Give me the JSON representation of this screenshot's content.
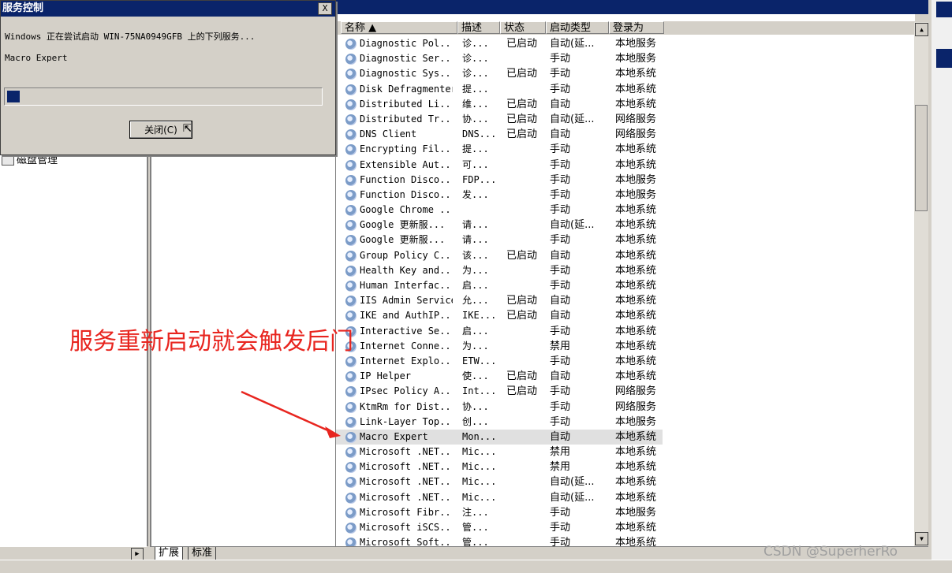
{
  "dialog": {
    "title": "服务控制",
    "close_glyph": "X",
    "message": "Windows 正在尝试启动 WIN-75NA0949GFB 上的下列服务...",
    "service": "Macro Expert",
    "progress_fraction": 0.04,
    "close_button": "关闭(C)"
  },
  "tree": {
    "item": "磁盘管理"
  },
  "list": {
    "columns": [
      "名称  ▲",
      "描述",
      "状态",
      "启动类型",
      "登录为"
    ],
    "rows": [
      {
        "name": "Diagnostic Pol...",
        "desc": "诊...",
        "status": "已启动",
        "start": "自动(延...",
        "logon": "本地服务"
      },
      {
        "name": "Diagnostic Ser...",
        "desc": "诊...",
        "status": "",
        "start": "手动",
        "logon": "本地服务"
      },
      {
        "name": "Diagnostic Sys...",
        "desc": "诊...",
        "status": "已启动",
        "start": "手动",
        "logon": "本地系统"
      },
      {
        "name": "Disk Defragmenter",
        "desc": "提...",
        "status": "",
        "start": "手动",
        "logon": "本地系统"
      },
      {
        "name": "Distributed Li...",
        "desc": "维...",
        "status": "已启动",
        "start": "自动",
        "logon": "本地系统"
      },
      {
        "name": "Distributed Tr...",
        "desc": "协...",
        "status": "已启动",
        "start": "自动(延...",
        "logon": "网络服务"
      },
      {
        "name": "DNS Client",
        "desc": "DNS...",
        "status": "已启动",
        "start": "自动",
        "logon": "网络服务"
      },
      {
        "name": "Encrypting Fil...",
        "desc": "提...",
        "status": "",
        "start": "手动",
        "logon": "本地系统"
      },
      {
        "name": "Extensible Aut...",
        "desc": "可...",
        "status": "",
        "start": "手动",
        "logon": "本地系统"
      },
      {
        "name": "Function Disco...",
        "desc": "FDP...",
        "status": "",
        "start": "手动",
        "logon": "本地服务"
      },
      {
        "name": "Function Disco...",
        "desc": "发...",
        "status": "",
        "start": "手动",
        "logon": "本地服务"
      },
      {
        "name": "Google Chrome ...",
        "desc": "",
        "status": "",
        "start": "手动",
        "logon": "本地系统"
      },
      {
        "name": "Google 更新服...",
        "desc": "请...",
        "status": "",
        "start": "自动(延...",
        "logon": "本地系统"
      },
      {
        "name": "Google 更新服...",
        "desc": "请...",
        "status": "",
        "start": "手动",
        "logon": "本地系统"
      },
      {
        "name": "Group Policy C...",
        "desc": "该...",
        "status": "已启动",
        "start": "自动",
        "logon": "本地系统"
      },
      {
        "name": "Health Key and...",
        "desc": "为...",
        "status": "",
        "start": "手动",
        "logon": "本地系统"
      },
      {
        "name": "Human Interfac...",
        "desc": "启...",
        "status": "",
        "start": "手动",
        "logon": "本地系统"
      },
      {
        "name": "IIS Admin Service",
        "desc": "允...",
        "status": "已启动",
        "start": "自动",
        "logon": "本地系统"
      },
      {
        "name": "IKE and AuthIP...",
        "desc": "IKE...",
        "status": "已启动",
        "start": "自动",
        "logon": "本地系统"
      },
      {
        "name": "Interactive Se...",
        "desc": "启...",
        "status": "",
        "start": "手动",
        "logon": "本地系统"
      },
      {
        "name": "Internet Conne...",
        "desc": "为...",
        "status": "",
        "start": "禁用",
        "logon": "本地系统"
      },
      {
        "name": "Internet Explo...",
        "desc": "ETW...",
        "status": "",
        "start": "手动",
        "logon": "本地系统"
      },
      {
        "name": "IP Helper",
        "desc": "使...",
        "status": "已启动",
        "start": "自动",
        "logon": "本地系统"
      },
      {
        "name": "IPsec Policy A...",
        "desc": "Int...",
        "status": "已启动",
        "start": "手动",
        "logon": "网络服务"
      },
      {
        "name": "KtmRm for Dist...",
        "desc": "协...",
        "status": "",
        "start": "手动",
        "logon": "网络服务"
      },
      {
        "name": "Link-Layer Top...",
        "desc": "创...",
        "status": "",
        "start": "手动",
        "logon": "本地服务"
      },
      {
        "name": "Macro Expert",
        "desc": "Mon...",
        "status": "",
        "start": "自动",
        "logon": "本地系统",
        "selected": true
      },
      {
        "name": "Microsoft .NET...",
        "desc": "Mic...",
        "status": "",
        "start": "禁用",
        "logon": "本地系统"
      },
      {
        "name": "Microsoft .NET...",
        "desc": "Mic...",
        "status": "",
        "start": "禁用",
        "logon": "本地系统"
      },
      {
        "name": "Microsoft .NET...",
        "desc": "Mic...",
        "status": "",
        "start": "自动(延...",
        "logon": "本地系统"
      },
      {
        "name": "Microsoft .NET...",
        "desc": "Mic...",
        "status": "",
        "start": "自动(延...",
        "logon": "本地系统"
      },
      {
        "name": "Microsoft Fibr...",
        "desc": "注...",
        "status": "",
        "start": "手动",
        "logon": "本地服务"
      },
      {
        "name": "Microsoft iSCS...",
        "desc": "管...",
        "status": "",
        "start": "手动",
        "logon": "本地系统"
      },
      {
        "name": "Microsoft Soft...",
        "desc": "管...",
        "status": "",
        "start": "手动",
        "logon": "本地系统"
      }
    ]
  },
  "tabs": [
    "扩展",
    "标准"
  ],
  "annotation": "服务重新启动就会触发后门",
  "watermark": "CSDN @SuperherRo",
  "colors": {
    "titlebar": "#0a246a",
    "annotation": "#e8251f",
    "window_face": "#d4d0c8"
  }
}
